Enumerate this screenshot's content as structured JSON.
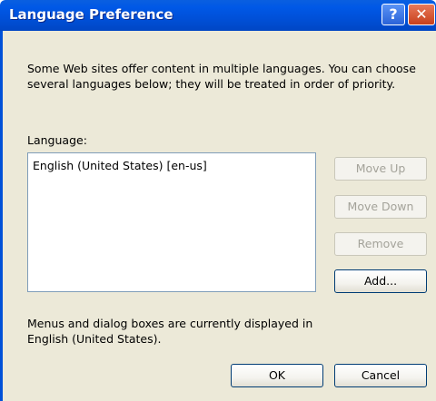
{
  "window": {
    "title": "Language Preference",
    "help_symbol": "?",
    "close_symbol": "✕"
  },
  "intro_text": "Some Web sites offer content in multiple languages. You can choose several languages below; they will be treated in order of priority.",
  "language_label": "Language:",
  "languages": [
    "English (United States) [en-us]"
  ],
  "buttons": {
    "move_up": "Move Up",
    "move_down": "Move Down",
    "remove": "Remove",
    "add": "Add...",
    "ok": "OK",
    "cancel": "Cancel"
  },
  "footer_text": "Menus and dialog boxes are currently displayed in English (United States).",
  "colors": {
    "titlebar": "#0054e3",
    "dialog_bg": "#ece9d8",
    "close_button": "#d04a1f"
  }
}
